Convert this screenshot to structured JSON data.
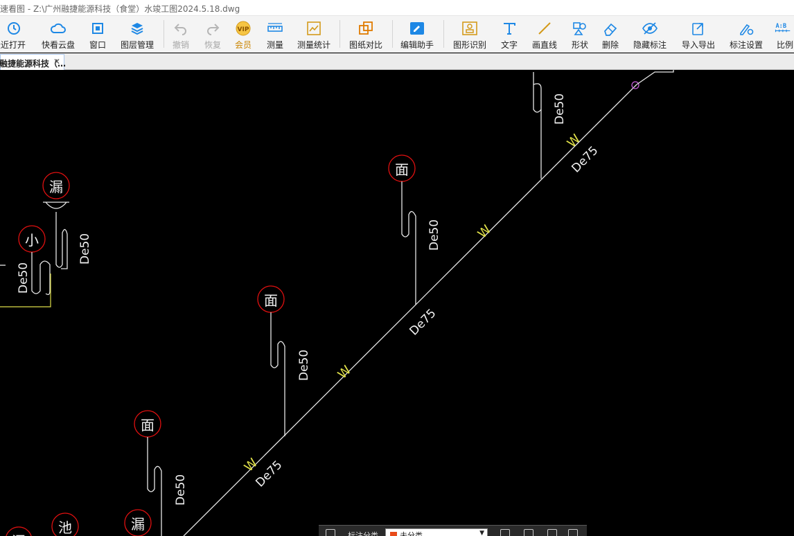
{
  "window": {
    "title": "速看图 - Z:\\广州融捷能源科技（食堂）水竣工图2024.5.18.dwg"
  },
  "toolbar": {
    "items": [
      {
        "label": "最近打开",
        "icon": "clock-icon"
      },
      {
        "label": "快看云盘",
        "icon": "cloud-icon"
      },
      {
        "label": "窗口",
        "icon": "window-icon"
      },
      {
        "label": "图层管理",
        "icon": "layers-icon"
      },
      {
        "label": "撤销",
        "icon": "undo-icon"
      },
      {
        "label": "恢复",
        "icon": "redo-icon"
      },
      {
        "label": "会员",
        "icon": "vip-icon",
        "badge": "VIP"
      },
      {
        "label": "测量",
        "icon": "ruler-icon"
      },
      {
        "label": "测量统计",
        "icon": "measure-stats-icon"
      },
      {
        "label": "图纸对比",
        "icon": "compare-icon"
      },
      {
        "label": "编辑助手",
        "icon": "edit-assistant-icon"
      },
      {
        "label": "图形识别",
        "icon": "shape-recognize-icon"
      },
      {
        "label": "文字",
        "icon": "text-icon"
      },
      {
        "label": "画直线",
        "icon": "line-icon"
      },
      {
        "label": "形状",
        "icon": "shape-icon"
      },
      {
        "label": "删除",
        "icon": "eraser-icon"
      },
      {
        "label": "隐藏标注",
        "icon": "eye-hide-icon"
      },
      {
        "label": "导入导出",
        "icon": "import-export-icon"
      },
      {
        "label": "标注设置",
        "icon": "annotation-settings-icon"
      },
      {
        "label": "比例",
        "icon": "scale-icon",
        "badge": "A:B"
      }
    ]
  },
  "tabs": [
    {
      "label": "广州融捷能源科技（…",
      "close": "✕"
    }
  ],
  "drawing": {
    "fixtures": [
      {
        "text": "漏"
      },
      {
        "text": "小"
      },
      {
        "text": "面"
      },
      {
        "text": "面"
      },
      {
        "text": "面"
      },
      {
        "text": "漏"
      },
      {
        "text": "池"
      },
      {
        "text": "漏"
      }
    ],
    "pipe_labels": {
      "riser": "De50",
      "main": "De75",
      "waste": "W"
    }
  },
  "float_panel": {
    "label": "标注分类",
    "selected": "未分类",
    "dropdown_icon": "▼"
  },
  "colors": {
    "canvas_bg": "#000000",
    "fixture_circle": "#e01010",
    "main_pipe": "#dede4a",
    "riser_pipe": "#e8e8e8",
    "accent_blue": "#1e88e5"
  }
}
